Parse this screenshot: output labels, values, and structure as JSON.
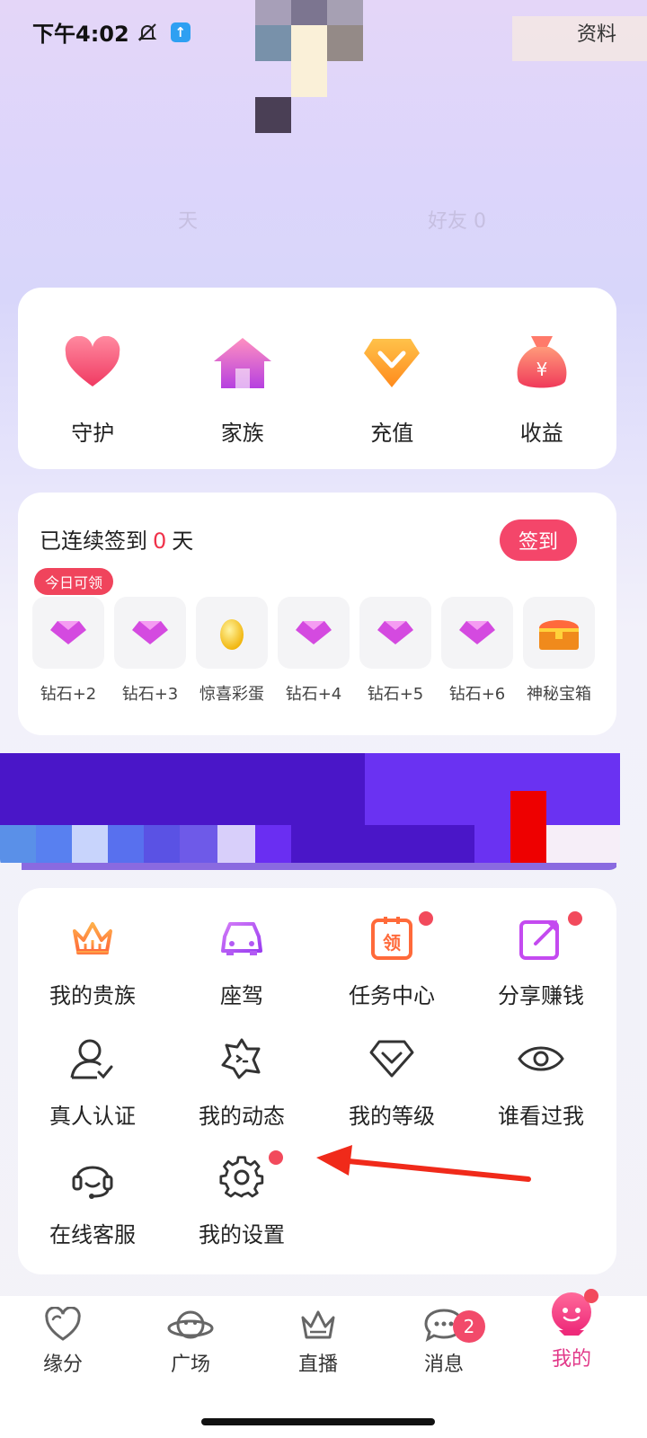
{
  "status": {
    "time": "下午4:02"
  },
  "header": {
    "profile_link": "资料",
    "stat_left": "天",
    "stat_right": "好友 0"
  },
  "features": [
    {
      "label": "守护",
      "icon": "heart-icon"
    },
    {
      "label": "家族",
      "icon": "house-icon"
    },
    {
      "label": "充值",
      "icon": "diamond-down-icon"
    },
    {
      "label": "收益",
      "icon": "money-bag-icon"
    }
  ],
  "checkin": {
    "prefix": "已连续签到",
    "days": "0",
    "suffix": "天",
    "button": "签到",
    "today_tag": "今日可领",
    "rewards": [
      {
        "label": "钻石+2",
        "icon": "gem-icon"
      },
      {
        "label": "钻石+3",
        "icon": "gem-icon"
      },
      {
        "label": "惊喜彩蛋",
        "icon": "golden-egg-icon"
      },
      {
        "label": "钻石+4",
        "icon": "gem-icon"
      },
      {
        "label": "钻石+5",
        "icon": "gem-icon"
      },
      {
        "label": "钻石+6",
        "icon": "gem-icon"
      },
      {
        "label": "神秘宝箱",
        "icon": "treasure-chest-icon"
      }
    ]
  },
  "menu": [
    {
      "label": "我的贵族",
      "icon": "crown-icon"
    },
    {
      "label": "座驾",
      "icon": "car-icon"
    },
    {
      "label": "任务中心",
      "icon": "task-icon"
    },
    {
      "label": "分享赚钱",
      "icon": "share-icon"
    },
    {
      "label": "真人认证",
      "icon": "user-verify-icon"
    },
    {
      "label": "我的动态",
      "icon": "moments-icon"
    },
    {
      "label": "我的等级",
      "icon": "level-icon"
    },
    {
      "label": "谁看过我",
      "icon": "eye-icon"
    },
    {
      "label": "在线客服",
      "icon": "headset-icon"
    },
    {
      "label": "我的设置",
      "icon": "settings-icon"
    }
  ],
  "tabs": [
    {
      "label": "缘分",
      "icon": "heart-outline-icon"
    },
    {
      "label": "广场",
      "icon": "planet-icon"
    },
    {
      "label": "直播",
      "icon": "crown-outline-icon"
    },
    {
      "label": "消息",
      "icon": "chat-icon",
      "badge": "2"
    },
    {
      "label": "我的",
      "icon": "profile-icon"
    }
  ],
  "colors": {
    "accent": "#f4466a",
    "purple": "#6a2ef2",
    "active_tab": "#e23a8a"
  }
}
